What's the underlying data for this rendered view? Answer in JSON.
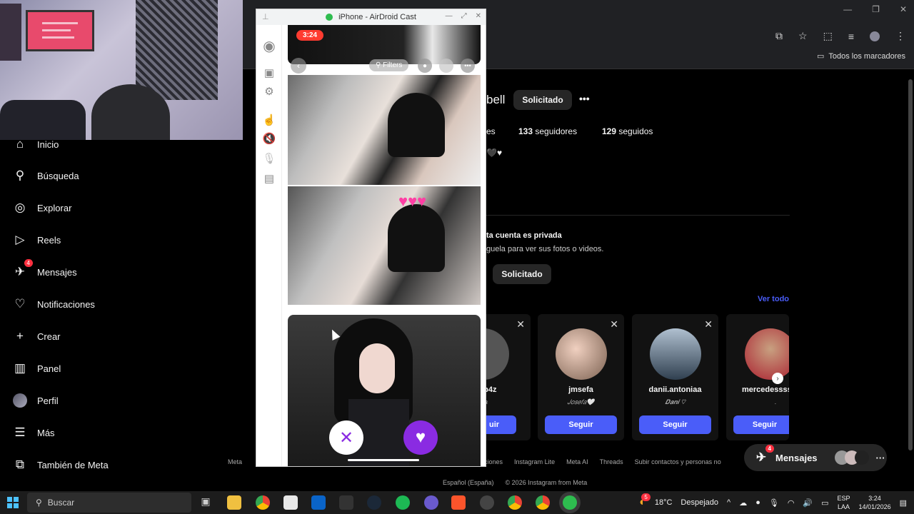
{
  "chrome": {
    "bookmarks_label": "Todos los marcadores",
    "win_controls": [
      "—",
      "❐",
      "✕"
    ]
  },
  "sidebar": {
    "items": [
      {
        "label": "Inicio",
        "icon": "home-icon"
      },
      {
        "label": "Búsqueda",
        "icon": "search-icon"
      },
      {
        "label": "Explorar",
        "icon": "compass-icon"
      },
      {
        "label": "Reels",
        "icon": "reels-icon"
      },
      {
        "label": "Mensajes",
        "icon": "messenger-icon",
        "badge": "4"
      },
      {
        "label": "Notificaciones",
        "icon": "heart-icon"
      },
      {
        "label": "Crear",
        "icon": "plus-icon"
      },
      {
        "label": "Panel",
        "icon": "chart-icon"
      },
      {
        "label": "Perfil",
        "icon": "avatar"
      },
      {
        "label": "Más",
        "icon": "menu-icon"
      },
      {
        "label": "También de Meta",
        "icon": "meta-icon"
      }
    ]
  },
  "profile": {
    "username_partial": "bell",
    "request_button": "Solicitado",
    "more": "•••",
    "posts_partial": "es",
    "followers_count": "133",
    "followers_label": "seguidores",
    "following_count": "129",
    "following_label": "seguidos",
    "private_title": "ta cuenta es privada",
    "private_sub": "guela para ver sus fotos o videos.",
    "private_button": "Solicitado",
    "see_all": "Ver todo"
  },
  "suggestions": [
    {
      "username": "_p4z",
      "sub": "itta",
      "follow": "uir"
    },
    {
      "username": "jmsefa",
      "sub": "𝐽𝑜𝑠𝑒𝑓𝑎🤍",
      "follow": "Seguir"
    },
    {
      "username": "danii.antoniaa",
      "sub": "𝑫𝒂𝒏𝒊 ♡",
      "follow": "Seguir"
    },
    {
      "username": "mercedessss.",
      "sub": ".",
      "follow": "Seguir"
    }
  ],
  "footer": {
    "links": [
      "Meta",
      "Ubicaciones",
      "Instagram Lite",
      "Meta AI",
      "Threads",
      "Subir contactos y personas no"
    ],
    "language": "Español (España)",
    "copyright": "© 2026 Instagram from Meta"
  },
  "messages_pill": {
    "label": "Mensajes",
    "badge": "4"
  },
  "airdroid": {
    "title": "iPhone - AirDroid Cast",
    "time": "3:24",
    "filters": "Filters"
  },
  "taskbar": {
    "search_placeholder": "Buscar",
    "weather_temp": "18°C",
    "weather_desc": "Despejado",
    "weather_badge": "5",
    "lang_top": "ESP",
    "lang_bottom": "LAA",
    "time": "3:24",
    "date": "14/01/2026"
  },
  "colors": {
    "accent_blue": "#4a5df9",
    "badge_red": "#ff3040",
    "like_purple": "#8a2be2"
  }
}
